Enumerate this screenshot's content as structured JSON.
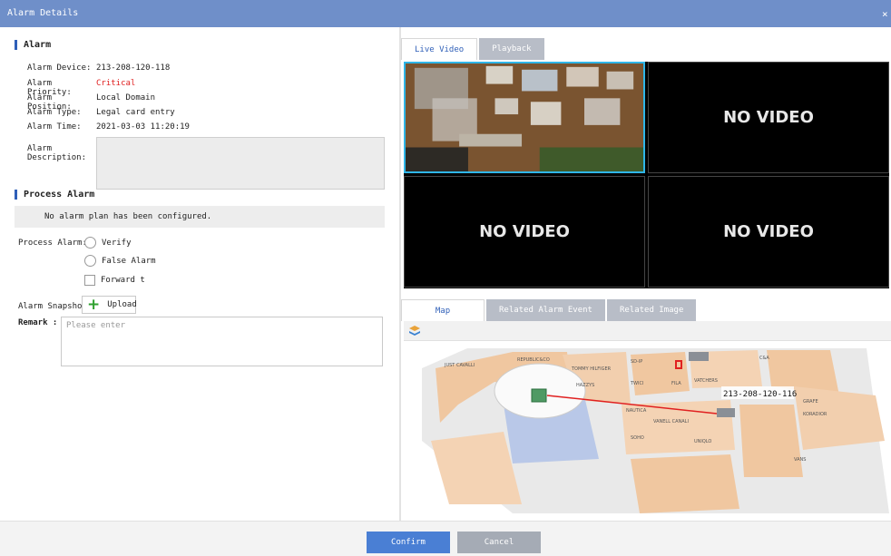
{
  "window": {
    "title": "Alarm Details",
    "close_glyph": "×"
  },
  "alarm": {
    "heading": "Alarm",
    "fields": [
      {
        "label": "Alarm Device:",
        "value": "213-208-120-118"
      },
      {
        "label": "Alarm Priority:",
        "value": "Critical"
      },
      {
        "label": "Alarm Position:",
        "value": "Local Domain"
      },
      {
        "label": "Alarm Type:",
        "value": "Legal card entry"
      },
      {
        "label": "Alarm Time:",
        "value": "2021-03-03 11:20:19"
      }
    ],
    "description_label_1": "Alarm",
    "description_label_2": "Description:",
    "description_value": ""
  },
  "process": {
    "heading": "Process Alarm",
    "no_plan_text": "No alarm plan has been configured.",
    "process_label": "Process Alarm:",
    "options": [
      "Verify",
      "False Alarm"
    ],
    "forward_label": "Forward t",
    "snapshot_label": "Alarm Snapshot:",
    "upload_label": "Upload",
    "remark_label": "Remark :",
    "remark_placeholder": "Please enter"
  },
  "video": {
    "tabs": [
      "Live Video",
      "Playback"
    ],
    "active_tab": "Live Video",
    "no_video_text": "NO VIDEO"
  },
  "map": {
    "tabs": [
      "Map",
      "Related Alarm Event",
      "Related Image"
    ],
    "active_tab": "Map",
    "camera_label": "213-208-120-116",
    "store_labels": [
      "JUST CAVALLI",
      "REPUBLIC&CO",
      "TOMMY HILFIGER",
      "HAZZYS",
      "TWICI",
      "FILA",
      "VATCHERS",
      "NAUTICA",
      "VANELL CANALI",
      "UNIQLO",
      "VANS",
      "KORADIOR",
      "GRAFE",
      "C&A",
      "SD-IP",
      "SOHO"
    ]
  },
  "footer": {
    "confirm_label": "Confirm",
    "cancel_label": "Cancel"
  },
  "colors": {
    "title_bar": "#6f8fc9",
    "accent": "#2f5fb8",
    "critical": "#e02020",
    "confirm": "#4a7fd4",
    "cancel": "#a5abb5",
    "selected_cell": "#2fb6e8"
  }
}
